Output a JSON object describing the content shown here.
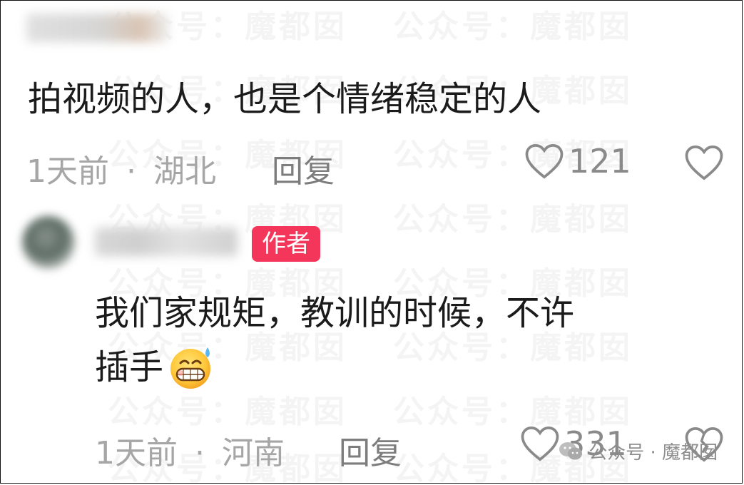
{
  "watermark": {
    "text": "公众号：魔都囡"
  },
  "comments": [
    {
      "text": "拍视频的人，也是个情绪稳定的人",
      "time": "1天前",
      "separator": "·",
      "location": "湖北",
      "reply_label": "回复",
      "likes": "121"
    },
    {
      "author_badge": "作者",
      "text_line1": "我们家规矩，教训的时候，不许",
      "text_line2": "插手",
      "emoji": "grinning-sweat-emoji",
      "time": "1天前",
      "separator": "·",
      "location": "河南",
      "reply_label": "回复",
      "likes": "331"
    }
  ],
  "footer_watermark": {
    "text": "公众号 · 魔都囡",
    "icon": "wechat-icon"
  },
  "colors": {
    "badge": "#f4365a",
    "meta": "#a6a6a6",
    "text": "#1b1b1b"
  }
}
